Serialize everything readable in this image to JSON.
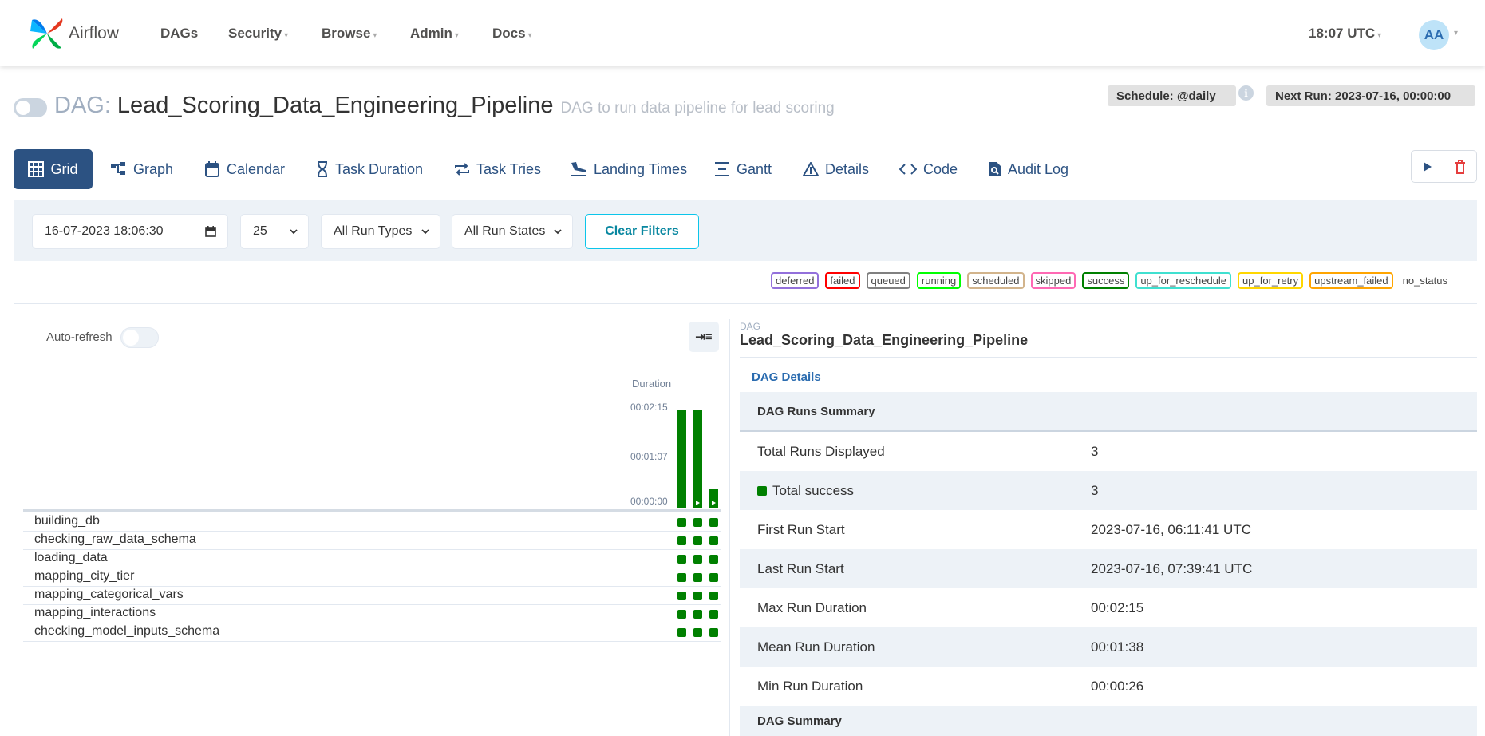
{
  "navbar": {
    "logo_text": "Airflow",
    "items": [
      {
        "label": "DAGs",
        "has_caret": false
      },
      {
        "label": "Security",
        "has_caret": true
      },
      {
        "label": "Browse",
        "has_caret": true
      },
      {
        "label": "Admin",
        "has_caret": true
      },
      {
        "label": "Docs",
        "has_caret": true
      }
    ],
    "time": "18:07 UTC",
    "avatar_initials": "AA"
  },
  "header": {
    "dag_prefix": "DAG:",
    "dag_id": "Lead_Scoring_Data_Engineering_Pipeline",
    "description": "DAG to run data pipeline for lead scoring",
    "schedule": "Schedule: @daily",
    "next_run": "Next Run: 2023-07-16, 00:00:00",
    "info_icon": "i",
    "paused": true
  },
  "tabs": [
    {
      "label": "Grid",
      "icon": "grid-icon",
      "active": true
    },
    {
      "label": "Graph",
      "icon": "graph-icon"
    },
    {
      "label": "Calendar",
      "icon": "calendar-icon"
    },
    {
      "label": "Task Duration",
      "icon": "hourglass-icon"
    },
    {
      "label": "Task Tries",
      "icon": "retry-icon"
    },
    {
      "label": "Landing Times",
      "icon": "plane-landing-icon"
    },
    {
      "label": "Gantt",
      "icon": "gantt-icon"
    },
    {
      "label": "Details",
      "icon": "warning-triangle-icon"
    },
    {
      "label": "Code",
      "icon": "code-icon"
    },
    {
      "label": "Audit Log",
      "icon": "file-search-icon"
    }
  ],
  "actions": {
    "trigger": "play-icon",
    "delete": "trash-icon"
  },
  "filters": {
    "base_date": "16-07-2023 18:06:30",
    "num_runs": "25",
    "run_types": "All Run Types",
    "run_states": "All Run States",
    "clear": "Clear Filters"
  },
  "legend": [
    {
      "label": "deferred",
      "color": "#9370db"
    },
    {
      "label": "failed",
      "color": "#ff0000"
    },
    {
      "label": "queued",
      "color": "#808080"
    },
    {
      "label": "running",
      "color": "#00ff00"
    },
    {
      "label": "scheduled",
      "color": "#d2b48c"
    },
    {
      "label": "skipped",
      "color": "#ff69b4"
    },
    {
      "label": "success",
      "color": "#008000"
    },
    {
      "label": "up_for_reschedule",
      "color": "#40e0d0"
    },
    {
      "label": "up_for_retry",
      "color": "#ffd700"
    },
    {
      "label": "upstream_failed",
      "color": "#ffa500"
    },
    {
      "label": "no_status",
      "color": null
    }
  ],
  "grid": {
    "auto_refresh_label": "Auto-refresh",
    "duration_label": "Duration",
    "ticks": [
      "00:02:15",
      "00:01:07",
      "00:00:00"
    ],
    "runs": [
      {
        "duration": "00:02:15",
        "duration_fraction": 1.0,
        "state": "success"
      },
      {
        "duration": "00:02:15",
        "duration_fraction": 1.0,
        "state": "success"
      },
      {
        "duration": "00:00:26",
        "duration_fraction": 0.19,
        "state": "success"
      }
    ],
    "tasks": [
      "building_db",
      "checking_raw_data_schema",
      "loading_data",
      "mapping_city_tier",
      "mapping_categorical_vars",
      "mapping_interactions",
      "checking_model_inputs_schema"
    ]
  },
  "details": {
    "crumb_label": "DAG",
    "crumb_name": "Lead_Scoring_Data_Engineering_Pipeline",
    "tab": "DAG Details",
    "runs_summary_title": "DAG Runs Summary",
    "rows": [
      {
        "label": "Total Runs Displayed",
        "value": "3"
      },
      {
        "label": "Total success",
        "value": "3",
        "swatch": "#008000"
      },
      {
        "label": "First Run Start",
        "value": "2023-07-16, 06:11:41 UTC"
      },
      {
        "label": "Last Run Start",
        "value": "2023-07-16, 07:39:41 UTC"
      },
      {
        "label": "Max Run Duration",
        "value": "00:02:15"
      },
      {
        "label": "Mean Run Duration",
        "value": "00:01:38"
      },
      {
        "label": "Min Run Duration",
        "value": "00:00:26"
      }
    ],
    "dag_summary_title": "DAG Summary"
  }
}
